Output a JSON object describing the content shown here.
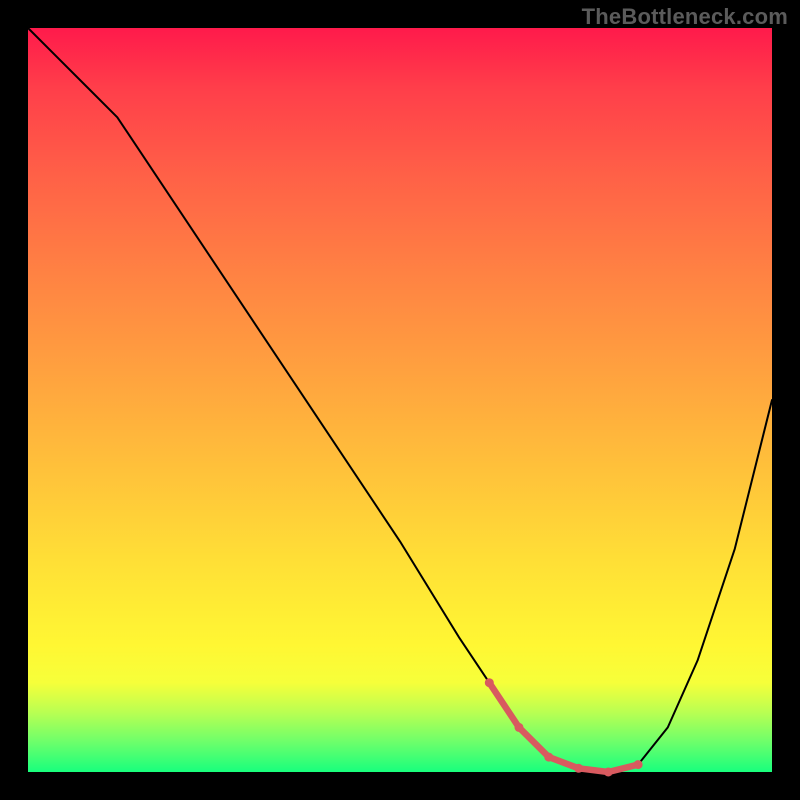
{
  "watermark": "TheBottleneck.com",
  "chart_data": {
    "type": "line",
    "title": "",
    "xlabel": "",
    "ylabel": "",
    "xlim": [
      0,
      100
    ],
    "ylim": [
      0,
      100
    ],
    "grid": false,
    "background_gradient": [
      "#ff1a4b",
      "#ff6147",
      "#ffa13f",
      "#ffe036",
      "#fff733",
      "#18ff7d"
    ],
    "series": [
      {
        "name": "bottleneck-curve",
        "color": "#000000",
        "x": [
          0,
          4,
          8,
          12,
          20,
          30,
          40,
          50,
          58,
          62,
          66,
          70,
          74,
          78,
          82,
          86,
          90,
          95,
          100
        ],
        "y": [
          100,
          96,
          92,
          88,
          76,
          61,
          46,
          31,
          18,
          12,
          6,
          2,
          0.5,
          0,
          1,
          6,
          15,
          30,
          50
        ]
      }
    ],
    "highlight": {
      "name": "optimal-range",
      "color": "#d85a5f",
      "x": [
        62,
        66,
        70,
        74,
        78,
        82
      ],
      "y": [
        12,
        6,
        2,
        0.5,
        0,
        1
      ]
    }
  }
}
